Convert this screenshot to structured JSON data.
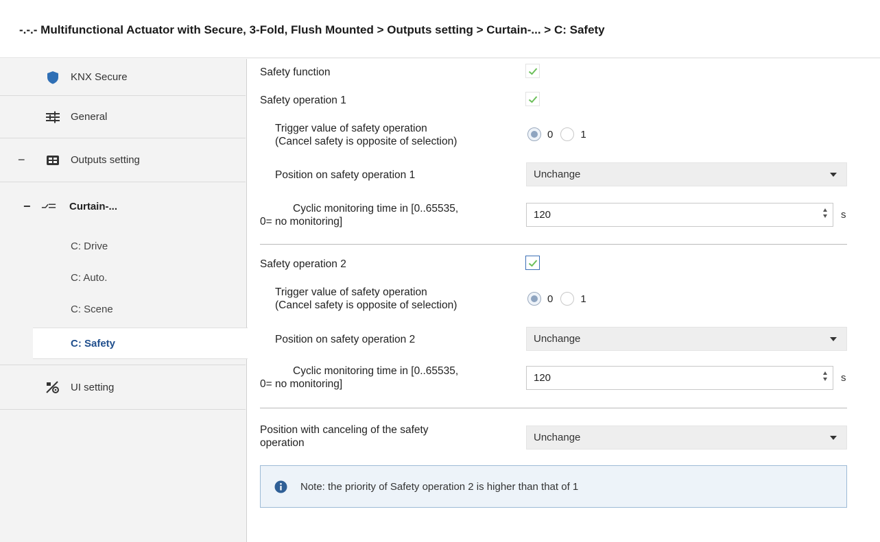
{
  "breadcrumb": "-.-.- Multifunctional Actuator with Secure, 3-Fold, Flush Mounted > Outputs setting > Curtain-... > C: Safety",
  "sidebar": {
    "items": [
      {
        "label": "KNX Secure",
        "icon": "shield-icon"
      },
      {
        "label": "General",
        "icon": "sliders-icon"
      },
      {
        "label": "Outputs setting",
        "icon": "outputs-icon",
        "expander": "−"
      },
      {
        "label": "Curtain-...",
        "icon": "curtain-icon",
        "expander": "−"
      },
      {
        "label": "UI setting",
        "icon": "ui-setting-icon"
      }
    ],
    "subitems": [
      "C: Drive",
      "C: Auto.",
      "C: Scene",
      "C: Safety"
    ],
    "active": "C: Safety"
  },
  "main": {
    "safety_function": {
      "label": "Safety function",
      "checked": true
    },
    "op1": {
      "label": "Safety operation 1",
      "checked": true,
      "trigger_label_1": "Trigger value of safety operation",
      "trigger_label_2": "(Cancel safety is opposite of  selection)",
      "radio_options": [
        "0",
        "1"
      ],
      "radio_selected": "0",
      "position_label": "Position on safety operation 1",
      "position_value": "Unchange",
      "cyclic_label_1": "Cyclic monitoring time in [0..65535,",
      "cyclic_label_2": "0= no monitoring]",
      "cyclic_value": "120",
      "unit": "s"
    },
    "op2": {
      "label": "Safety operation 2",
      "checked": true,
      "trigger_label_1": "Trigger value of safety operation",
      "trigger_label_2": "(Cancel safety is opposite of  selection)",
      "radio_options": [
        "0",
        "1"
      ],
      "radio_selected": "0",
      "position_label": "Position on safety operation 2",
      "position_value": "Unchange",
      "cyclic_label_1": "Cyclic monitoring time in [0..65535,",
      "cyclic_label_2": "0= no monitoring]",
      "cyclic_value": "120",
      "unit": "s"
    },
    "cancel": {
      "label_1": "Position with canceling of the safety",
      "label_2": "operation",
      "value": "Unchange"
    },
    "note": "Note: the priority of Safety operation 2 is higher than that of 1"
  },
  "colors": {
    "accent": "#1f4e8c",
    "check": "#6bbf59",
    "note_bg": "#edf3f9",
    "note_border": "#9dbad6"
  }
}
